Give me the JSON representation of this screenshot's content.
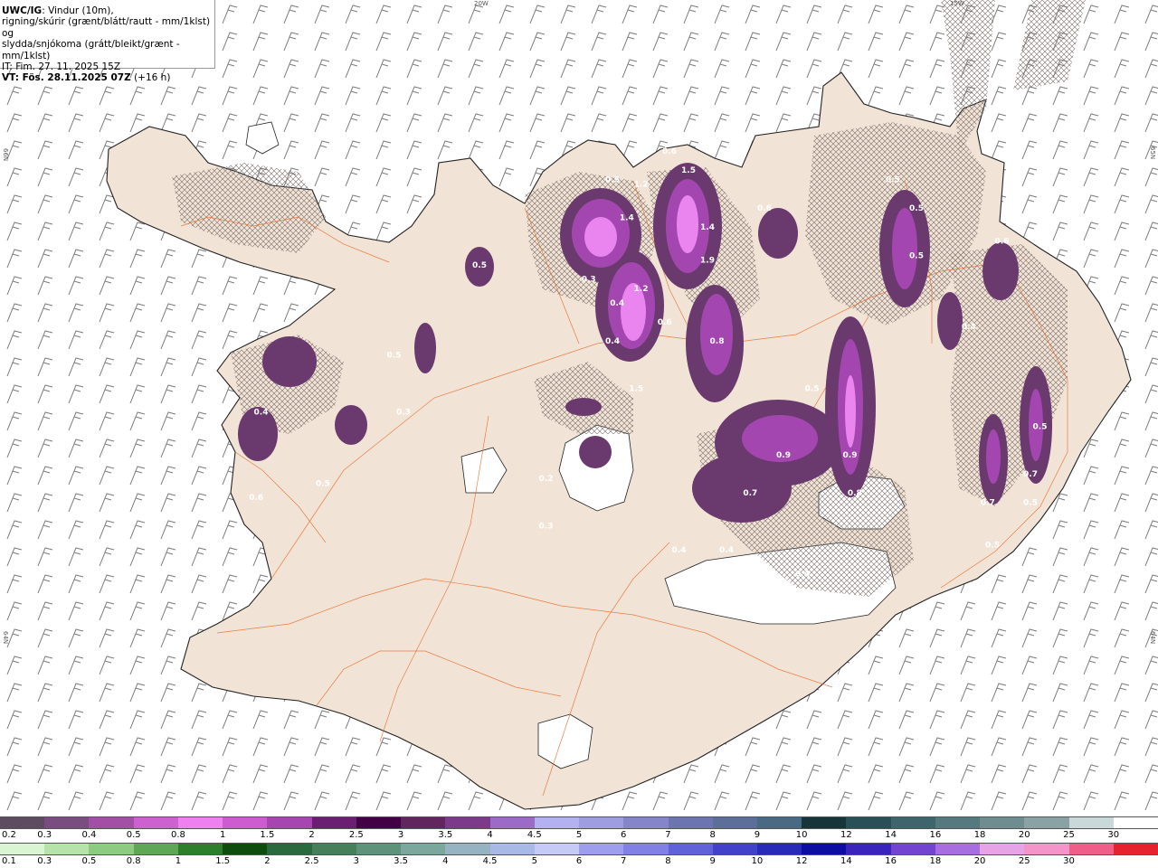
{
  "title": {
    "code": "UWC/IG",
    "line1_rest": ": Vindur (10m),",
    "line2": "rigning/skúrir (grænt/blátt/rautt - mm/1klst) og",
    "line3": "slydda/snjókoma (grátt/bleikt/grænt - mm/1klst)",
    "it": "IT: Fim. 27. 11. 2025 15Z",
    "vt": "VT: Fös. 28.11.2025 07Z",
    "vt_lead": " (+16 h)"
  },
  "grid_labels": {
    "top_20w": "20W",
    "top_15w": "15W",
    "left_66n": "66N",
    "right_65n": "65N",
    "left_64n": "64N",
    "right_64n": "64N"
  },
  "map_labels": [
    {
      "text": "0.5",
      "lon": -18.6,
      "lat": 66.04
    },
    {
      "text": "1.2",
      "lon": -18.3,
      "lat": 66.03
    },
    {
      "text": "1.4",
      "lon": -18.45,
      "lat": 65.96
    },
    {
      "text": "0.6",
      "lon": -18.0,
      "lat": 66.1
    },
    {
      "text": "1.5",
      "lon": -17.8,
      "lat": 66.06
    },
    {
      "text": "1.4",
      "lon": -17.6,
      "lat": 65.94
    },
    {
      "text": "1.9",
      "lon": -17.6,
      "lat": 65.87
    },
    {
      "text": "0.3",
      "lon": -18.85,
      "lat": 65.83
    },
    {
      "text": "0.4",
      "lon": -18.55,
      "lat": 65.78
    },
    {
      "text": "1.2",
      "lon": -18.3,
      "lat": 65.81
    },
    {
      "text": "0.4",
      "lon": -18.6,
      "lat": 65.7
    },
    {
      "text": "0.6",
      "lon": -18.05,
      "lat": 65.74
    },
    {
      "text": "0.8",
      "lon": -17.5,
      "lat": 65.7
    },
    {
      "text": "1.5",
      "lon": -18.35,
      "lat": 65.6
    },
    {
      "text": "0.6",
      "lon": -17.0,
      "lat": 65.98
    },
    {
      "text": "0.5",
      "lon": -15.65,
      "lat": 66.04
    },
    {
      "text": "0.5",
      "lon": -15.4,
      "lat": 65.98
    },
    {
      "text": "0.5",
      "lon": -15.4,
      "lat": 65.88
    },
    {
      "text": "0.6",
      "lon": -14.5,
      "lat": 65.91
    },
    {
      "text": "0.4",
      "lon": -14.85,
      "lat": 65.73
    },
    {
      "text": "0.5",
      "lon": -16.5,
      "lat": 65.6
    },
    {
      "text": "0.9",
      "lon": -16.1,
      "lat": 65.46
    },
    {
      "text": "0.8",
      "lon": -16.05,
      "lat": 65.38
    },
    {
      "text": "0.9",
      "lon": -16.8,
      "lat": 65.46
    },
    {
      "text": "0.7",
      "lon": -17.15,
      "lat": 65.38
    },
    {
      "text": "0.4",
      "lon": -17.9,
      "lat": 65.26
    },
    {
      "text": "0.4",
      "lon": -17.4,
      "lat": 65.26
    },
    {
      "text": "0.3",
      "lon": -17.2,
      "lat": 65.24
    },
    {
      "text": "0.4",
      "lon": -16.6,
      "lat": 65.21
    },
    {
      "text": "0.5",
      "lon": -14.1,
      "lat": 65.52
    },
    {
      "text": "0.7",
      "lon": -14.2,
      "lat": 65.42
    },
    {
      "text": "0.7",
      "lon": -14.65,
      "lat": 65.36
    },
    {
      "text": "0.5",
      "lon": -14.2,
      "lat": 65.36
    },
    {
      "text": "0.5",
      "lon": -14.6,
      "lat": 65.27
    },
    {
      "text": "0.5",
      "lon": -20.0,
      "lat": 65.86
    },
    {
      "text": "0.5",
      "lon": -20.9,
      "lat": 65.67
    },
    {
      "text": "0.3",
      "lon": -20.8,
      "lat": 65.55
    },
    {
      "text": "0.4",
      "lon": -22.3,
      "lat": 65.55
    },
    {
      "text": "0.5",
      "lon": -21.65,
      "lat": 65.4
    },
    {
      "text": "0.6",
      "lon": -22.35,
      "lat": 65.37
    },
    {
      "text": "0.2",
      "lon": -19.3,
      "lat": 65.41
    },
    {
      "text": "0.3",
      "lon": -19.3,
      "lat": 65.31
    }
  ],
  "snow_scale": {
    "colors": [
      "#5e4a61",
      "#7a4d80",
      "#a24fa6",
      "#cc61cf",
      "#ee80ef",
      "#cc5ccf",
      "#a846b1",
      "#6a1f72",
      "#440044",
      "#62265f",
      "#7c3b8a",
      "#9b6cc7",
      "#b4b1f0",
      "#9e9de0",
      "#8585c9",
      "#6d75b0",
      "#5d6f98",
      "#4a6a84",
      "#16343a",
      "#2a5057",
      "#3e646c",
      "#56797f",
      "#6f8d91",
      "#8aa2a4",
      "#c9d8d8",
      "#ffffff"
    ],
    "labels": [
      "0.2",
      "0.3",
      "0.4",
      "0.5",
      "0.8",
      "1",
      "1.5",
      "2",
      "2.5",
      "3",
      "3.5",
      "4",
      "4.5",
      "5",
      "6",
      "7",
      "8",
      "9",
      "10",
      "12",
      "14",
      "16",
      "18",
      "20",
      "25",
      "30"
    ]
  },
  "rain_scale": {
    "colors": [
      "#d9f5d3",
      "#b5e3aa",
      "#8ecb82",
      "#5fa657",
      "#2e7f2b",
      "#0e4d0e",
      "#2b6a3e",
      "#467f59",
      "#5f927b",
      "#7ba79c",
      "#95b3c0",
      "#a9b9e5",
      "#c5cbf5",
      "#9e9eef",
      "#8080e6",
      "#6161d8",
      "#4141c9",
      "#2a2ab8",
      "#0d0da3",
      "#3a24bb",
      "#7244d0",
      "#a66ee0",
      "#e6a4e6",
      "#f494c8",
      "#ef5e88",
      "#e5222e"
    ],
    "labels": [
      "0.1",
      "0.3",
      "0.5",
      "0.8",
      "1",
      "1.5",
      "2",
      "2.5",
      "3",
      "3.5",
      "4",
      "4.5",
      "5",
      "6",
      "7",
      "8",
      "9",
      "10",
      "12",
      "14",
      "16",
      "18",
      "20",
      "25",
      "30"
    ]
  },
  "style": {
    "land": "#f1e4d6",
    "coast": "#222222",
    "road": "#e76a2a",
    "barb": "#7a7a7a",
    "hatch": "#7a6e6a"
  }
}
